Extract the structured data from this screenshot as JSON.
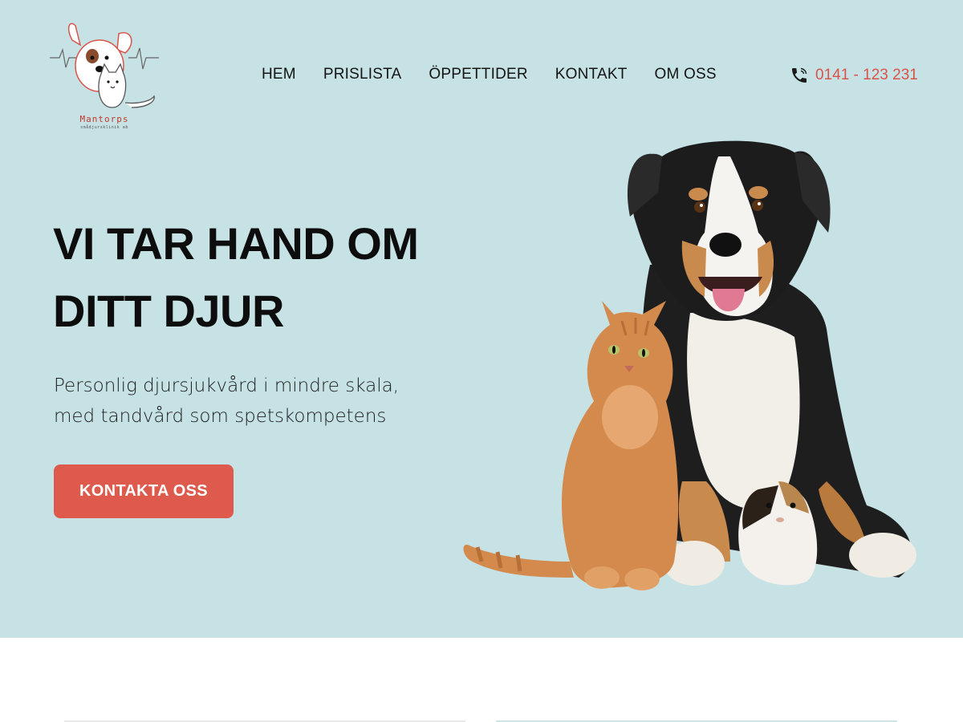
{
  "brand": {
    "name": "Mantorps",
    "subtitle": "smådjursklinik ab",
    "logo_icon": "dog-cat-heartbeat-logo",
    "accent_color": "#dd5a4c"
  },
  "nav": {
    "items": [
      {
        "label": "HEM"
      },
      {
        "label": "PRISLISTA"
      },
      {
        "label": "ÖPPETTIDER"
      },
      {
        "label": "KONTAKT"
      },
      {
        "label": "OM OSS"
      }
    ]
  },
  "contact": {
    "phone_icon": "phone-icon",
    "phone_number": "0141 - 123 231"
  },
  "hero": {
    "headline_line1": "VI TAR HAND OM",
    "headline_line2": "DITT DJUR",
    "subtitle_line1": "Personlig djursjukvård i mindre skala,",
    "subtitle_line2": "med tandvård som spetskompetens",
    "cta_label": "KONTAKTA OSS",
    "background_color": "#c6e2e5",
    "image": "dog-cat-guinea-pig-photo"
  }
}
